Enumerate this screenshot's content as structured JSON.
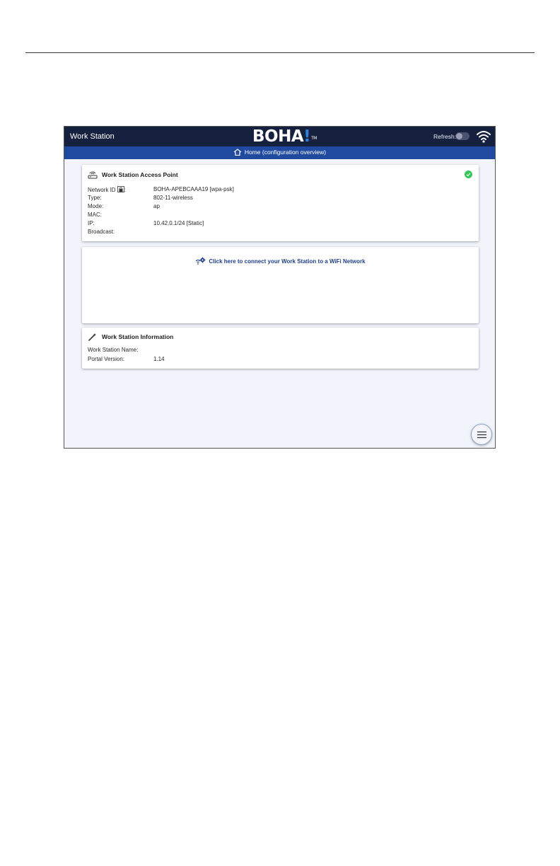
{
  "header": {
    "app_title": "Work Station",
    "logo_main": "BOHA",
    "logo_accent": "!",
    "logo_tm": "TM",
    "refresh_label": "Refresh:"
  },
  "nav": {
    "home_label": "Home (configuration overview)"
  },
  "access_point": {
    "title": "Work Station Access Point",
    "status_icon": "check-circle-icon",
    "rows": [
      {
        "label": "Network ID",
        "label_suffix": ":",
        "value": "BOHA-APEBCAAA19 [wpa-psk]"
      },
      {
        "label": "Type:",
        "value": "802-11-wireless"
      },
      {
        "label": "Mode:",
        "value": "ap"
      },
      {
        "label": "MAC:",
        "value": ""
      },
      {
        "label": "IP:",
        "value": "10.42.0.1/24 [Static]"
      },
      {
        "label": "Broadcast:",
        "value": ""
      }
    ]
  },
  "wifi_connect": {
    "link_text": "Click here to connect your Work Station  to a WiFi Network"
  },
  "info": {
    "title": "Work Station Information",
    "rows": [
      {
        "label": "Work Station Name:",
        "value": ""
      },
      {
        "label": "Portal Version:",
        "value": "1.14"
      }
    ]
  },
  "colors": {
    "topbar": "#16213f",
    "navbar": "#1f4aa0",
    "accent": "#2f7fd8",
    "link": "#1f3f8a",
    "ok": "#34c759"
  }
}
